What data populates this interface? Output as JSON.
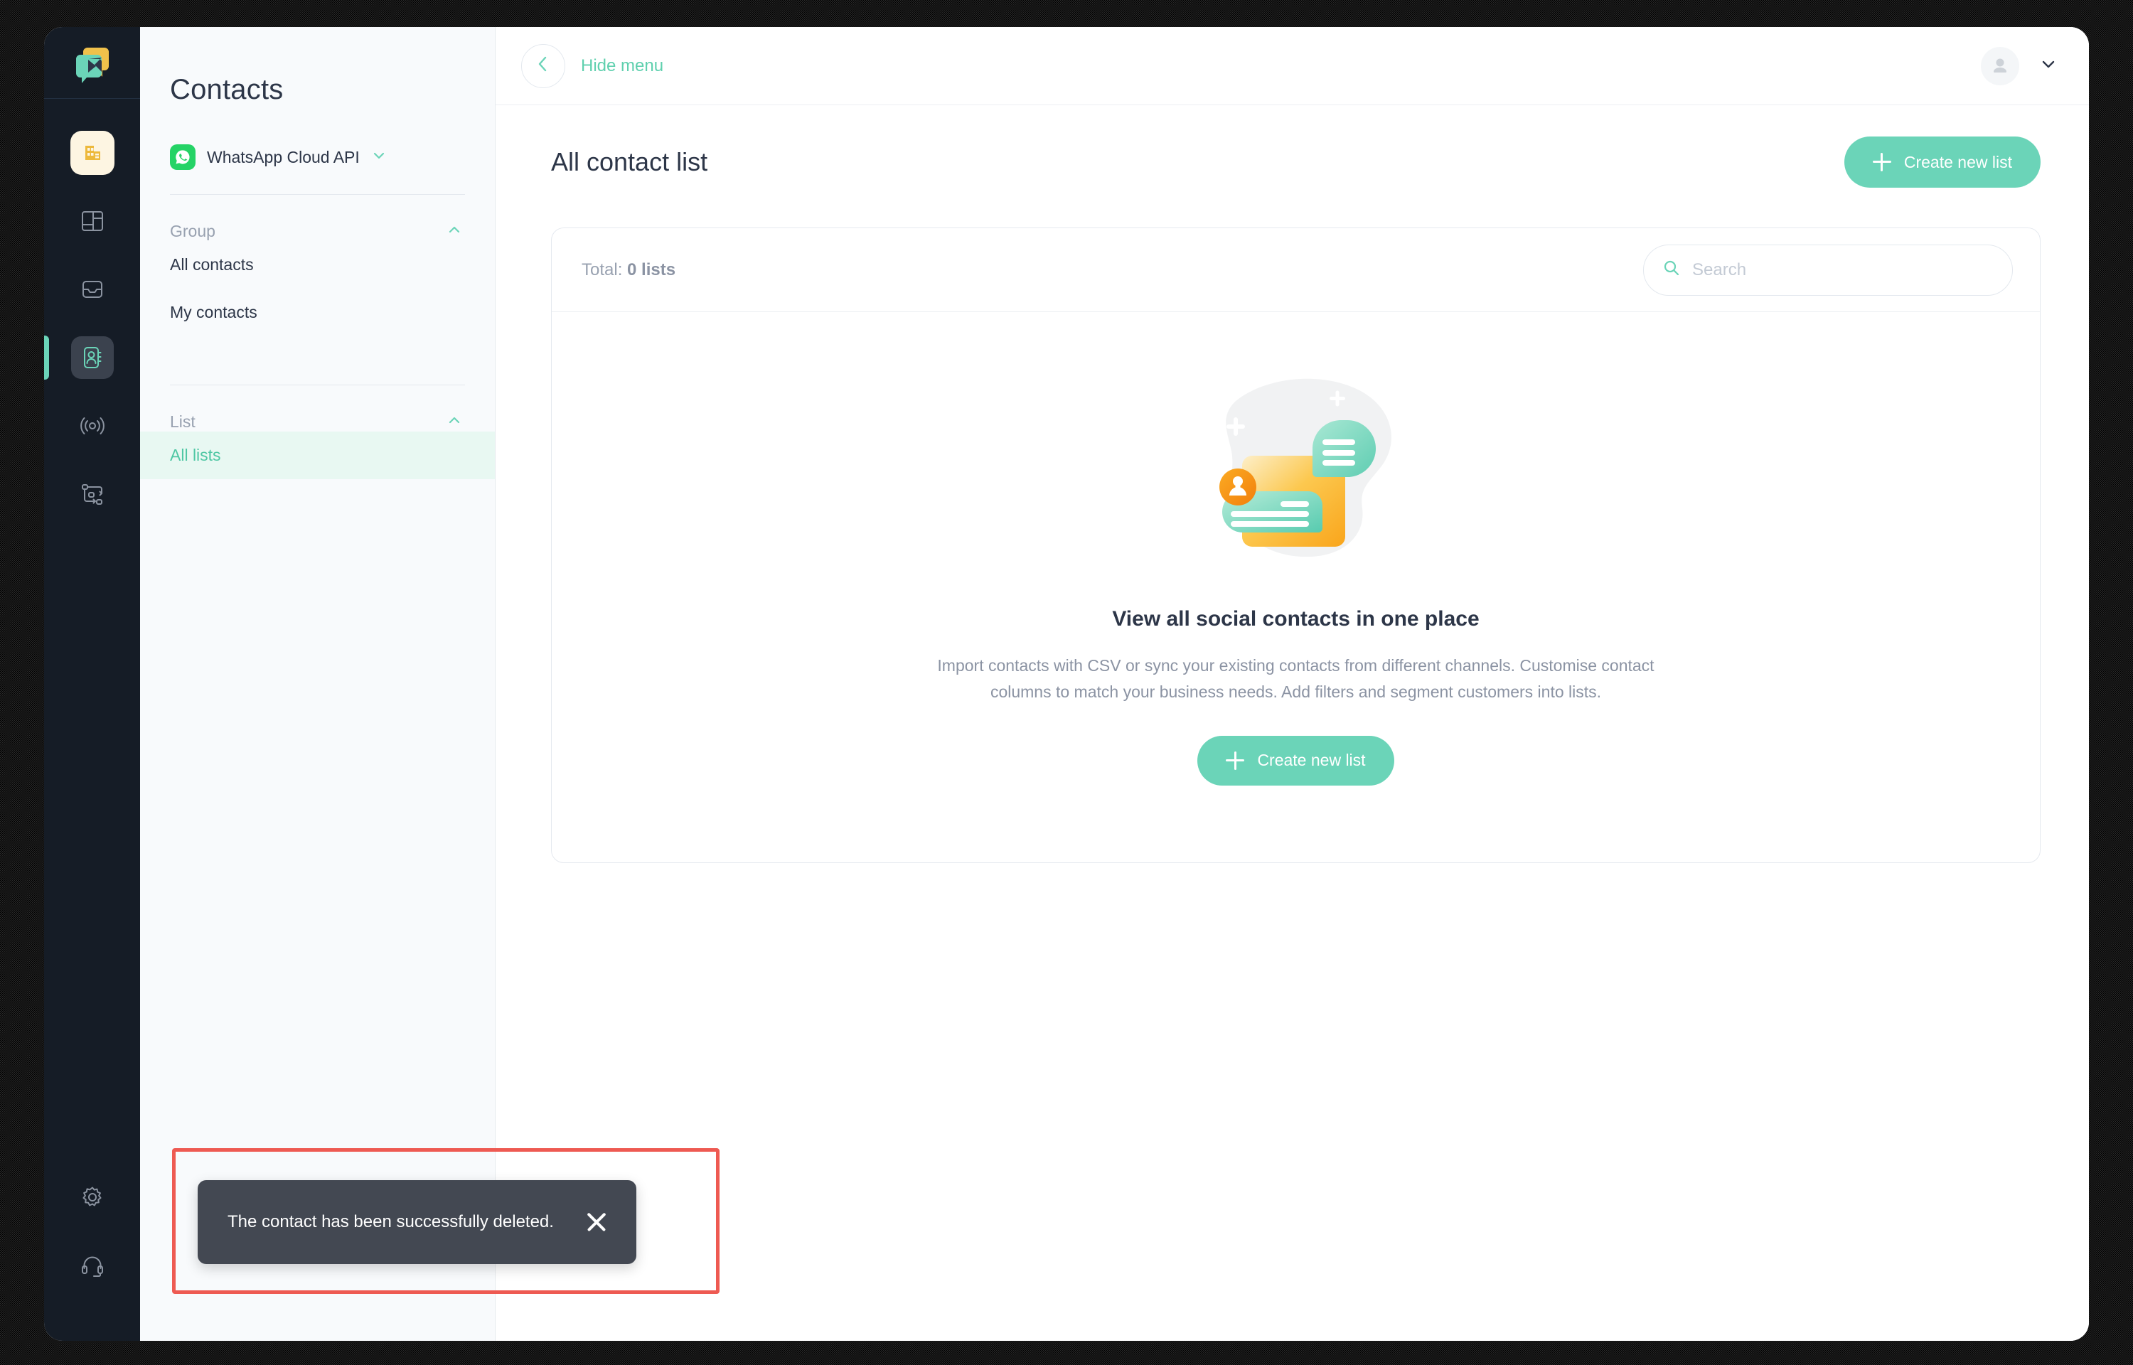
{
  "brand": {
    "logo_icon": "chat-bubbles-logo",
    "accent": "#6bd4b8",
    "accent_dark": "#4fc7a4",
    "amber": "#f0c14b",
    "orange": "#f89b1c",
    "dark_navy": "#151c26",
    "toast_bg": "#434852",
    "annotation_red": "#ee5a52"
  },
  "rail": {
    "logo_name": "app-logo",
    "business_icon": "building-icon",
    "items": [
      {
        "name": "dashboard-icon",
        "active": false
      },
      {
        "name": "inbox-icon",
        "active": false
      },
      {
        "name": "contacts-icon",
        "active": true
      },
      {
        "name": "broadcast-icon",
        "active": false
      },
      {
        "name": "automation-flow-icon",
        "active": false
      }
    ],
    "bottom_items": [
      {
        "name": "settings-gear-icon"
      },
      {
        "name": "support-headset-icon"
      }
    ]
  },
  "panel": {
    "title": "Contacts",
    "channel": {
      "label": "WhatsApp Cloud API",
      "icon": "whatsapp-icon",
      "chevron": "chevron-down-icon"
    },
    "sections": [
      {
        "title": "Group",
        "chevron": "chevron-up-icon",
        "items": [
          {
            "label": "All contacts",
            "selected": false
          },
          {
            "label": "My contacts",
            "selected": false
          }
        ]
      },
      {
        "title": "List",
        "chevron": "chevron-up-icon",
        "items": [
          {
            "label": "All lists",
            "selected": true
          }
        ]
      }
    ]
  },
  "topbar": {
    "back_icon": "chevron-left-icon",
    "hide_menu_label": "Hide menu",
    "avatar_icon": "user-avatar-icon",
    "profile_chevron": "chevron-down-icon"
  },
  "main": {
    "page_title": "All contact list",
    "create_button_label": "Create new list",
    "create_button_icon": "plus-icon",
    "card": {
      "total_prefix": "Total: ",
      "total_value": "0 lists",
      "search_placeholder": "Search",
      "search_value": "",
      "search_icon": "search-icon"
    },
    "empty_state": {
      "illustration": "contacts-empty-illustration",
      "title": "View all social contacts in one place",
      "description": "Import contacts with CSV or sync your existing contacts from different channels. Customise contact columns to match your business needs. Add filters and segment customers into lists.",
      "button_label": "Create new list",
      "button_icon": "plus-icon"
    }
  },
  "toast": {
    "message": "The contact has been successfully deleted.",
    "close_icon": "close-icon"
  }
}
